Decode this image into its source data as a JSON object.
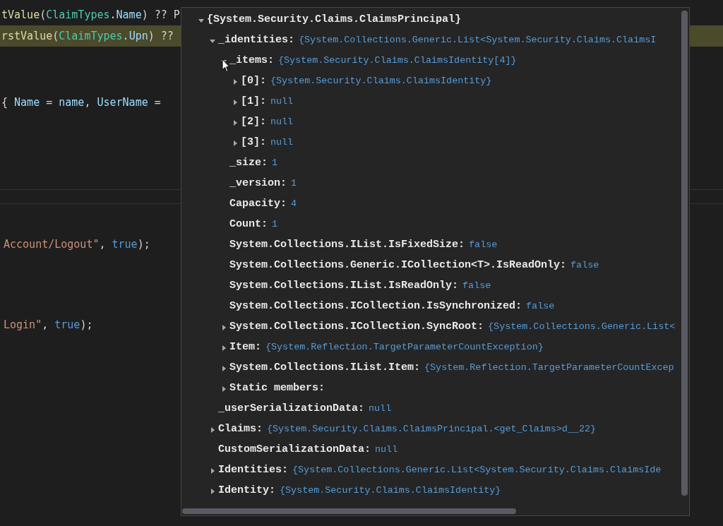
{
  "editor": {
    "upper_lines": [
      {
        "highlighted": false,
        "tokens": [
          {
            "text": "tValue",
            "kind": "method"
          },
          {
            "text": "(",
            "kind": "plain"
          },
          {
            "text": "ClaimTypes",
            "kind": "type"
          },
          {
            "text": ".",
            "kind": "plain"
          },
          {
            "text": "Name",
            "kind": "member"
          },
          {
            "text": ") ?? P",
            "kind": "plain"
          }
        ]
      },
      {
        "highlighted": true,
        "tokens": [
          {
            "text": "rstValue",
            "kind": "method"
          },
          {
            "text": "(",
            "kind": "plain"
          },
          {
            "text": "ClaimTypes",
            "kind": "type"
          },
          {
            "text": ".",
            "kind": "plain"
          },
          {
            "text": "Upn",
            "kind": "member"
          },
          {
            "text": ") ??",
            "kind": "plain"
          }
        ]
      },
      {
        "highlighted": false,
        "tokens": [
          {
            "text": "{ ",
            "kind": "plain"
          },
          {
            "text": "Name",
            "kind": "member"
          },
          {
            "text": " = ",
            "kind": "plain"
          },
          {
            "text": "name",
            "kind": "member"
          },
          {
            "text": ", ",
            "kind": "plain"
          },
          {
            "text": "UserName",
            "kind": "member"
          },
          {
            "text": " =",
            "kind": "plain"
          }
        ]
      }
    ],
    "lower_lines": [
      {
        "highlighted": false,
        "tokens": [
          {
            "text": "Account/Logout\"",
            "kind": "string"
          },
          {
            "text": ", ",
            "kind": "plain"
          },
          {
            "text": "true",
            "kind": "keyword"
          },
          {
            "text": ");",
            "kind": "plain"
          }
        ]
      },
      {
        "highlighted": false,
        "tokens": [
          {
            "text": "Login\"",
            "kind": "string"
          },
          {
            "text": ", ",
            "kind": "plain"
          },
          {
            "text": "true",
            "kind": "keyword"
          },
          {
            "text": ");",
            "kind": "plain"
          }
        ]
      }
    ]
  },
  "data_tip": {
    "tree": [
      {
        "name": "{System.Security.Claims.ClaimsPrincipal}",
        "expanded": true,
        "children": [
          {
            "name": "_identities:",
            "value": "{System.Collections.Generic.List<System.Security.Claims.ClaimsI",
            "expanded": true,
            "children": [
              {
                "name": "_items:",
                "value": "{System.Security.Claims.ClaimsIdentity[4]}",
                "expanded": true,
                "children": [
                  {
                    "name": "[0]:",
                    "value": "{System.Security.Claims.ClaimsIdentity}",
                    "expanded": false
                  },
                  {
                    "name": "[1]:",
                    "value": "null",
                    "expanded": false
                  },
                  {
                    "name": "[2]:",
                    "value": "null",
                    "expanded": false
                  },
                  {
                    "name": "[3]:",
                    "value": "null",
                    "expanded": false
                  }
                ]
              },
              {
                "name": "_size:",
                "value": "1"
              },
              {
                "name": "_version:",
                "value": "1"
              },
              {
                "name": "Capacity:",
                "value": "4"
              },
              {
                "name": "Count:",
                "value": "1"
              },
              {
                "name": "System.Collections.IList.IsFixedSize:",
                "value": "false"
              },
              {
                "name": "System.Collections.Generic.ICollection<T>.IsReadOnly:",
                "value": "false"
              },
              {
                "name": "System.Collections.IList.IsReadOnly:",
                "value": "false"
              },
              {
                "name": "System.Collections.ICollection.IsSynchronized:",
                "value": "false"
              },
              {
                "name": "System.Collections.ICollection.SyncRoot:",
                "value": "{System.Collections.Generic.List<",
                "expanded": false
              },
              {
                "name": "Item:",
                "value": "{System.Reflection.TargetParameterCountException}",
                "expanded": false
              },
              {
                "name": "System.Collections.IList.Item:",
                "value": "{System.Reflection.TargetParameterCountExcep",
                "expanded": false
              },
              {
                "name": "Static members:",
                "expanded": false
              }
            ]
          },
          {
            "name": "_userSerializationData:",
            "value": "null"
          },
          {
            "name": "Claims:",
            "value": "{System.Security.Claims.ClaimsPrincipal.<get_Claims>d__22}",
            "expanded": false
          },
          {
            "name": "CustomSerializationData:",
            "value": "null"
          },
          {
            "name": "Identities:",
            "value": "{System.Collections.Generic.List<System.Security.Claims.ClaimsIde",
            "expanded": false
          },
          {
            "name": "Identity:",
            "value": "{System.Security.Claims.ClaimsIdentity}",
            "expanded": false
          }
        ]
      }
    ]
  }
}
